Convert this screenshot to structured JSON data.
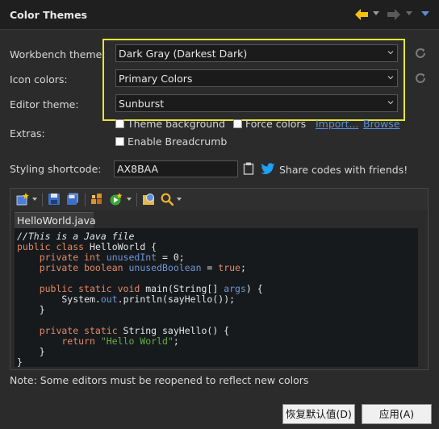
{
  "window": {
    "title": "Color Themes"
  },
  "nav": {
    "back_icon": "arrow-left-icon",
    "forward_icon": "arrow-right-icon",
    "menu_icon": "chevron-down-icon",
    "accent": "#f5c211"
  },
  "form": {
    "workbench_label": "Workbench theme:",
    "workbench_value": "Dark Gray (Darkest Dark)",
    "icon_label": "Icon colors:",
    "icon_value": "Primary Colors",
    "editor_label": "Editor theme:",
    "editor_value": "Sunburst",
    "extras_label": "Extras:",
    "extras": [
      {
        "label": "Theme background",
        "checked": false
      },
      {
        "label": "Force colors",
        "checked": false
      },
      {
        "label": "Enable Breadcrumb",
        "checked": false
      }
    ],
    "import_link": "Import...",
    "browse_link": "Browse",
    "shortcode_label": "Styling shortcode:",
    "shortcode_value": "AX8BAA",
    "share_text": "Share codes with friends!",
    "highlight_color": "#e6e638"
  },
  "preview": {
    "tab_label": "HelloWorld.java",
    "toolbar_icons": [
      "new-file-icon",
      "save-icon",
      "save-all-icon",
      "build-icon",
      "run-icon",
      "debug-icon",
      "search-icon"
    ],
    "code": {
      "l1": "//This is a Java file",
      "l2a": "public class",
      "l2b": " HelloWorld {",
      "l3a": "    private int ",
      "l3b": "unusedInt",
      "l3c": " = 0;",
      "l4a": "    private boolean ",
      "l4b": "unusedBoolean",
      "l4c": " = ",
      "l4d": "true",
      "l4e": ";",
      "l6a": "    public static void",
      "l6b": " main(String[] ",
      "l6c": "args",
      "l6d": ") {",
      "l7a": "        System.",
      "l7b": "out",
      "l7c": ".println(sayHello());",
      "l8": "    }",
      "l10a": "    private static",
      "l10b": " String sayHello() {",
      "l11a": "        return ",
      "l11b": "\"Hello World\"",
      "l11c": ";",
      "l12": "    }",
      "l13": "}"
    }
  },
  "note": "Note: Some editors must be reopened to reflect new colors",
  "buttons": {
    "restore": "恢复默认值(D)",
    "apply": "应用(A)"
  }
}
